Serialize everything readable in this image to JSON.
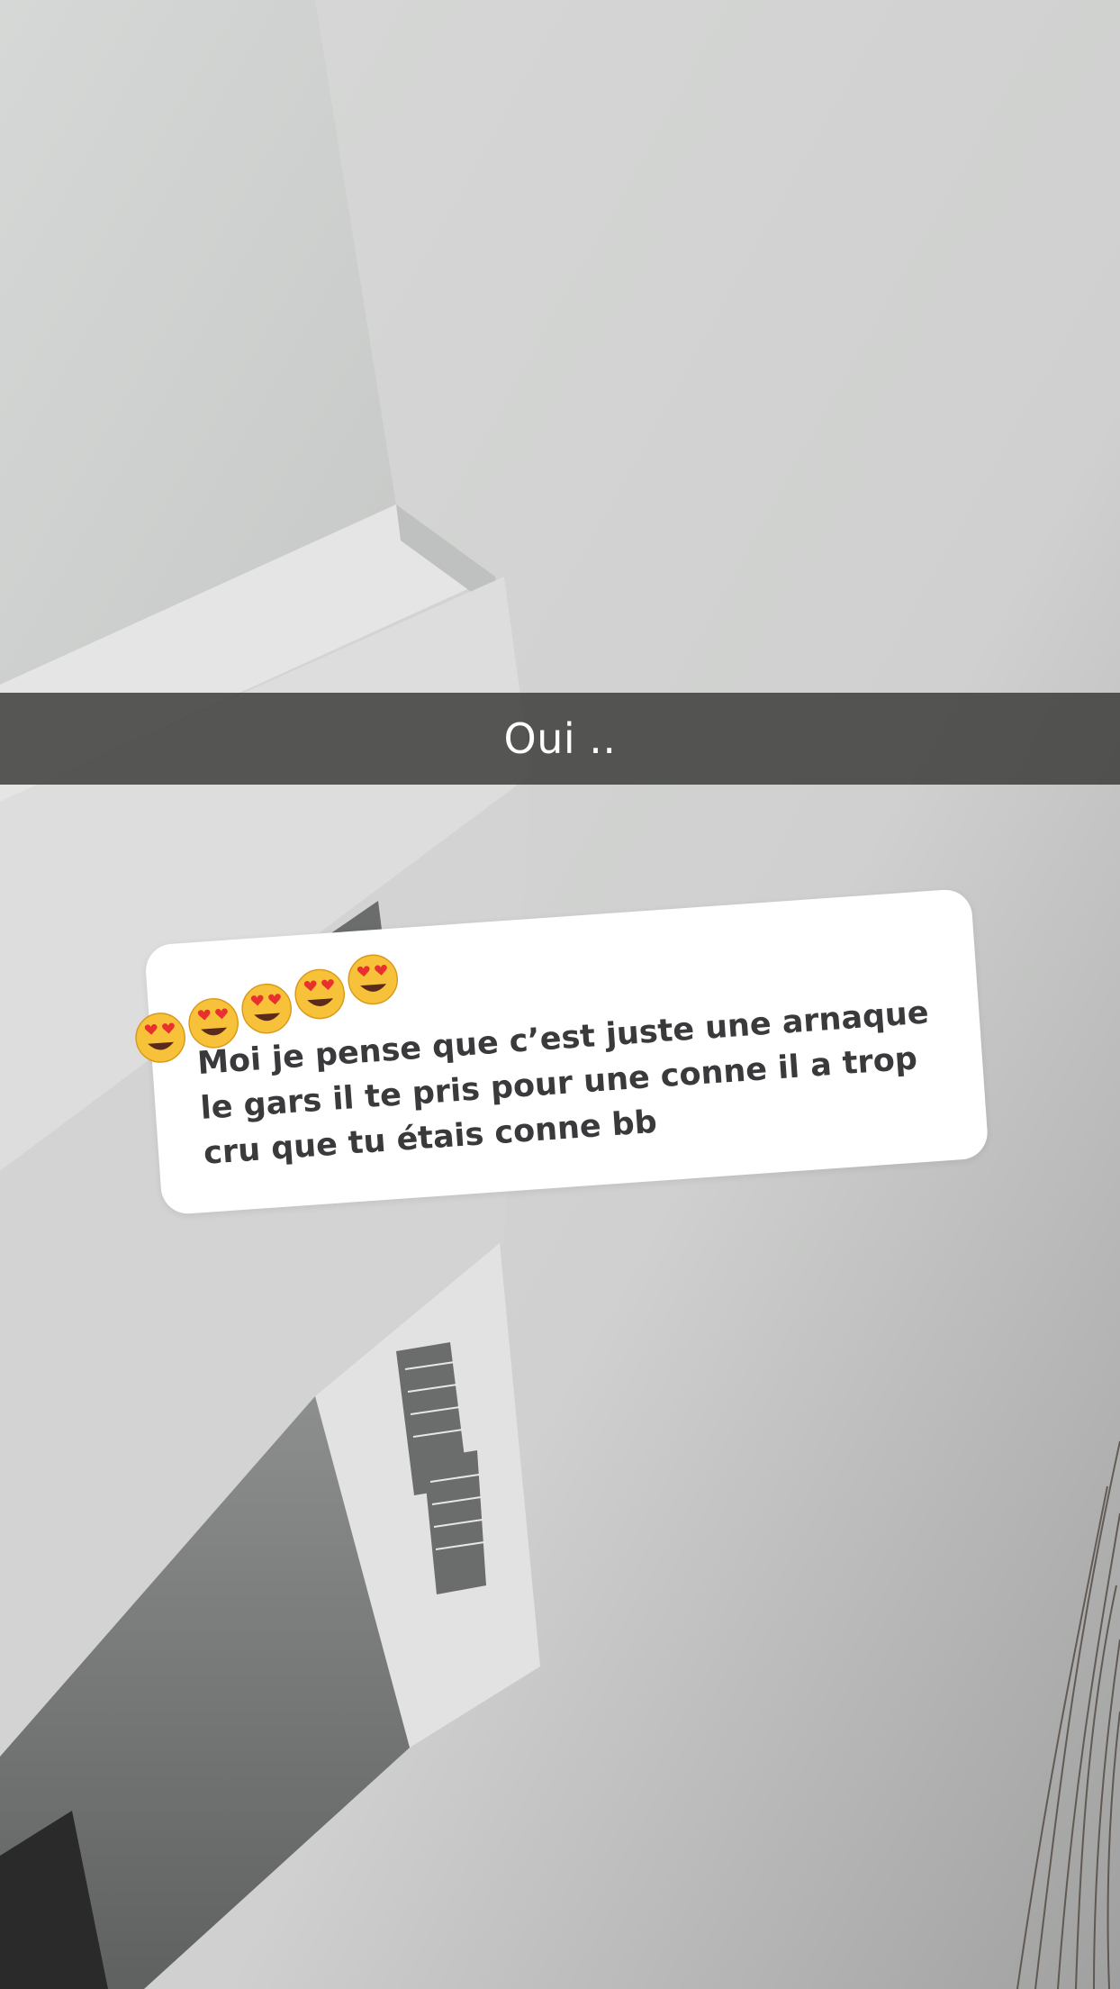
{
  "caption": {
    "text": "Oui .."
  },
  "reply": {
    "text": "Moi je pense que c’est juste une arnaque le gars il te pris pour une conne il a trop cru que tu étais conne bb",
    "emoji_icon": "heart-eyes-emoji-icon",
    "emoji_count": 5
  },
  "colors": {
    "caption_bar": "#373734",
    "card": "#ffffff",
    "reply_text": "#3a3a3c",
    "emoji_face": "#f7c23a",
    "emoji_heart": "#e8312f"
  }
}
